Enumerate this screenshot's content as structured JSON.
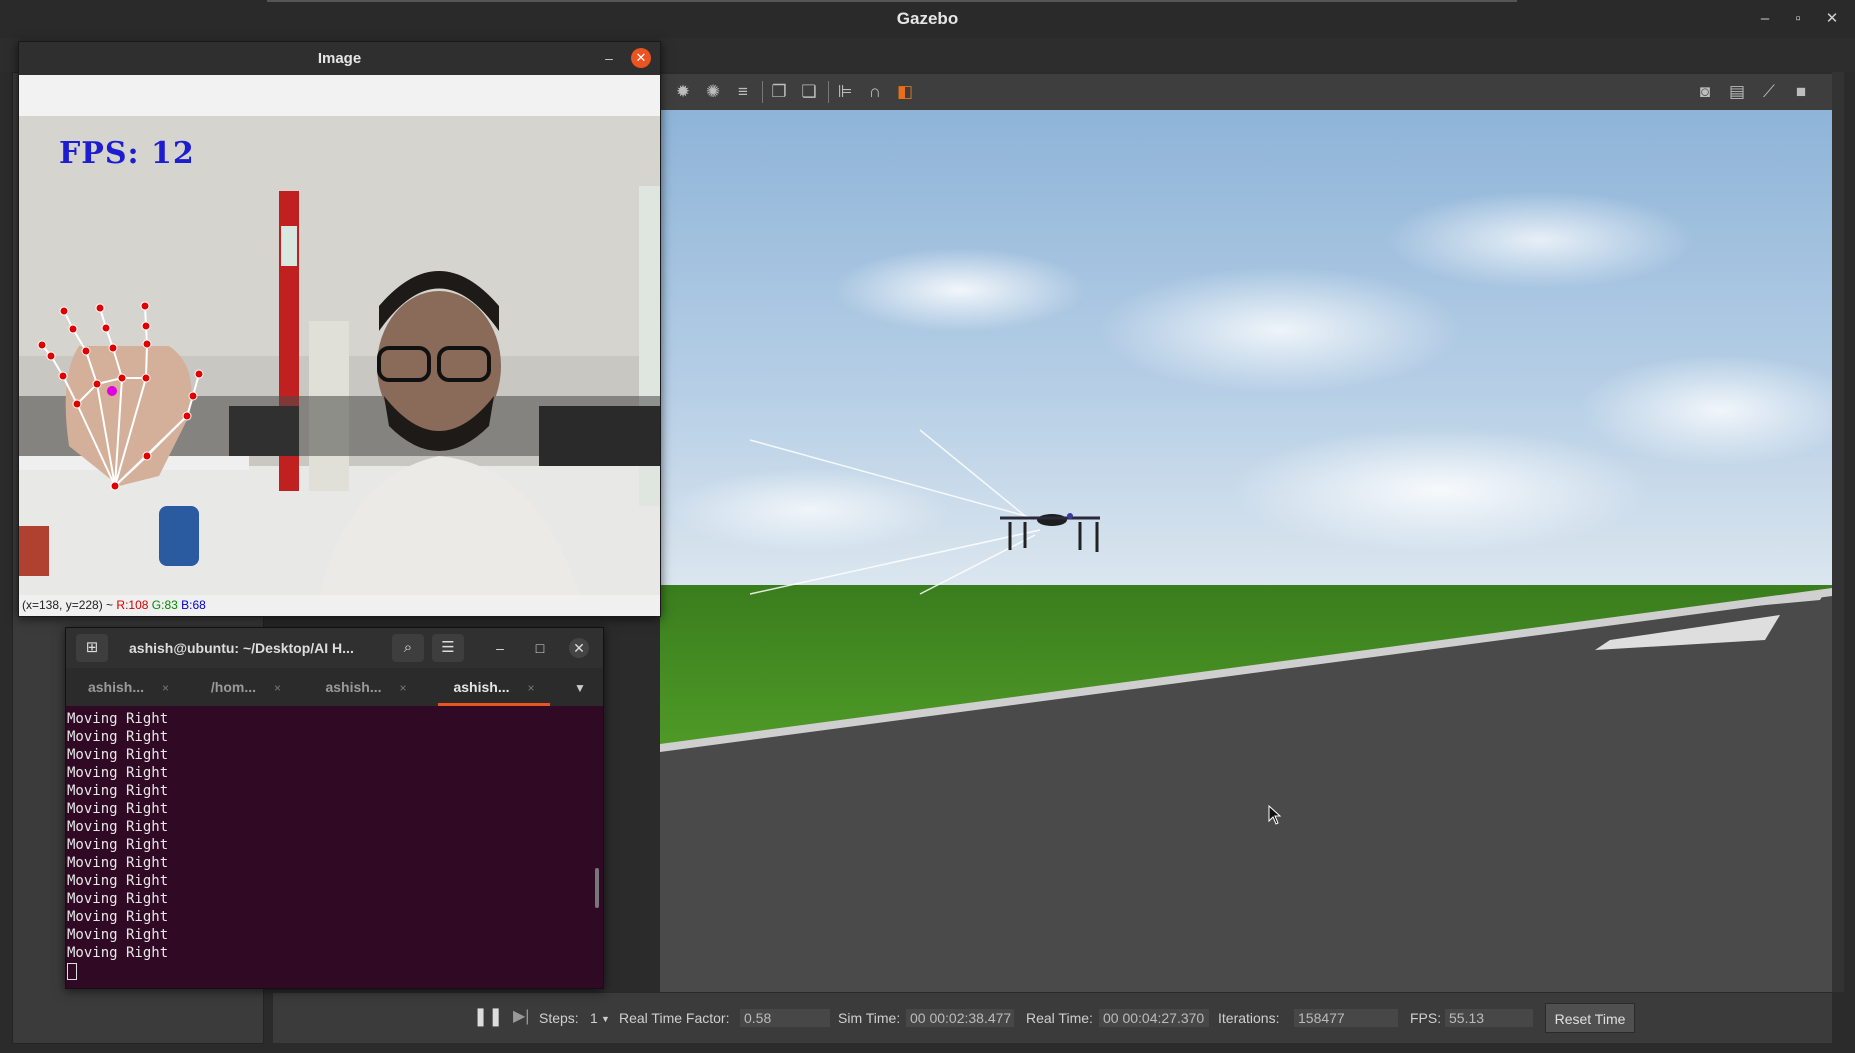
{
  "gazebo": {
    "window_title": "Gazebo",
    "window_controls": {
      "minimize": "–",
      "maximize": "▫",
      "close": "✕"
    },
    "toolbar_icons": [
      "sun-icon",
      "spot-light-icon",
      "directional-light-icon",
      "copy-icon",
      "paste-icon",
      "align-icon",
      "magnet-icon",
      "snap-icon",
      "screenshot-icon",
      "log-icon",
      "plot-icon",
      "video-record-icon"
    ],
    "bottom": {
      "steps_label": "Steps:",
      "steps_value": "1",
      "rtf_label": "Real Time Factor:",
      "rtf_value": "0.58",
      "sim_time_label": "Sim Time:",
      "sim_time_value": "00 00:02:38.477",
      "real_time_label": "Real Time:",
      "real_time_value": "00 00:04:27.370",
      "iterations_label": "Iterations:",
      "iterations_value": "158477",
      "fps_label": "FPS:",
      "fps_value": "55.13",
      "reset_label": "Reset Time"
    }
  },
  "image_window": {
    "title": "Image",
    "fps_overlay": "FPS: 12",
    "status": {
      "coords": "(x=138, y=228) ~ ",
      "r": "R:108",
      "g": "G:83",
      "b": "B:68"
    },
    "colors": {
      "r": "#d40000",
      "g": "#008a00",
      "b": "#0000c8",
      "fps": "#1c1cd0",
      "landmark": "#e00000",
      "fingertip_highlight": "#e000e0"
    }
  },
  "terminal": {
    "title": "ashish@ubuntu: ~/Desktop/AI H...",
    "tabs": [
      {
        "label": "ashish..."
      },
      {
        "label": "/hom..."
      },
      {
        "label": "ashish..."
      },
      {
        "label": "ashish..."
      }
    ],
    "tab_close": "×",
    "lines": [
      "Moving Right",
      "Moving Right",
      "Moving Right",
      "Moving Right",
      "Moving Right",
      "Moving Right",
      "Moving Right",
      "Moving Right",
      "Moving Right",
      "Moving Right",
      "Moving Right",
      "Moving Right",
      "Moving Right",
      "Moving Right"
    ]
  }
}
